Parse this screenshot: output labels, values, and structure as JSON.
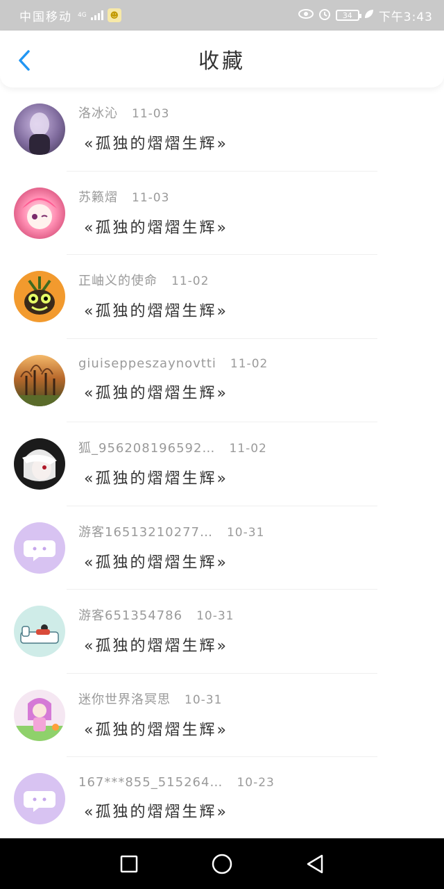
{
  "status_bar": {
    "carrier": "中国移动",
    "network": "4G",
    "battery": "34",
    "time": "下午3:43"
  },
  "header": {
    "title": "收藏",
    "back_icon": "chevron-left-icon"
  },
  "colors": {
    "accent": "#2196F3",
    "text_primary": "#333333",
    "text_meta": "#9a9a9a"
  },
  "favorites": [
    {
      "user": "洛冰沁",
      "date": "11-03",
      "title": "«孤独的熠熠生辉»",
      "avatar": "photo-avatar"
    },
    {
      "user": "苏籁熠",
      "date": "11-03",
      "title": "«孤独的熠熠生辉»",
      "avatar": "anime-pink-hair-avatar"
    },
    {
      "user": "正岫义的使命",
      "date": "11-02",
      "title": "«孤独的熠熠生辉»",
      "avatar": "orange-monster-avatar"
    },
    {
      "user": "giuiseppeszaynovtti",
      "date": "11-02",
      "title": "«孤独的熠熠生辉»",
      "avatar": "forest-photo-avatar"
    },
    {
      "user": "狐_956208196592…",
      "date": "11-02",
      "title": "«孤独的熠熠生辉»",
      "avatar": "anime-silver-hair-avatar"
    },
    {
      "user": "游客16513210277…",
      "date": "10-31",
      "title": "«孤独的熠熠生辉»",
      "avatar": "chat-bubble-avatar"
    },
    {
      "user": "游客651354786",
      "date": "10-31",
      "title": "«孤独的熠熠生辉»",
      "avatar": "sofa-illustration-avatar"
    },
    {
      "user": "迷你世界洛冥思",
      "date": "10-31",
      "title": "«孤独的熠熠生辉»",
      "avatar": "chibi-girl-avatar"
    },
    {
      "user": "167***855_515264…",
      "date": "10-23",
      "title": "«孤独的熠熠生辉»",
      "avatar": "chat-bubble-avatar"
    }
  ]
}
